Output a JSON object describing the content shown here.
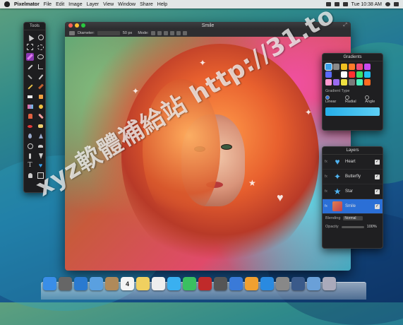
{
  "menubar": {
    "items": [
      "Pixelmator",
      "File",
      "Edit",
      "Image",
      "Layer",
      "View",
      "Window",
      "Share",
      "Help"
    ],
    "clock": "Tue 10:38 AM"
  },
  "tools_panel": {
    "title": "Tools"
  },
  "window": {
    "title": "Smile",
    "options": {
      "diameter_label": "Diameter:",
      "diameter_value": "50 px",
      "mode_label": "Mode:"
    }
  },
  "gradients_panel": {
    "title": "Gradients",
    "type_label": "Gradient Type",
    "types": [
      "Linear",
      "Radial",
      "Angle"
    ],
    "swatches": [
      "#3aa0e8",
      "#8a8a8a",
      "#f0c020",
      "#ff7a2a",
      "#f04a7a",
      "#c84af0",
      "#5a6aff",
      "#1a1a1a",
      "#ffffff",
      "#ff3030",
      "#3adf6a",
      "#20c0f0",
      "#ff9ad0",
      "#9a6af0",
      "#f0e040",
      "#7a7a7a",
      "#4af0c0",
      "#ff6a20"
    ]
  },
  "layers_panel": {
    "title": "Layers",
    "layers": [
      {
        "name": "Heart",
        "icon": "heart-icon",
        "selected": false
      },
      {
        "name": "Butterfly",
        "icon": "butterfly-icon",
        "selected": false
      },
      {
        "name": "Star",
        "icon": "star-icon",
        "selected": false
      },
      {
        "name": "Smile",
        "icon": "photo-thumbnail",
        "selected": true
      }
    ],
    "blending_label": "Blending",
    "blending_value": "Normal",
    "opacity_label": "Opacity",
    "opacity_value": "100%"
  },
  "dock": {
    "icons": [
      "finder-icon",
      "launchpad-icon",
      "safari-icon",
      "mail-icon",
      "contacts-icon",
      "calendar-icon",
      "notes-icon",
      "reminders-icon",
      "messages-icon",
      "facetime-icon",
      "photo-booth-icon",
      "iphoto-icon",
      "itunes-icon",
      "ibooks-icon",
      "app-store-icon",
      "preferences-icon",
      "pixelmator-icon",
      "applications-folder-icon",
      "trash-icon"
    ],
    "calendar_day": "4"
  },
  "watermark": "xyz軟體補給站 http://31.to",
  "colors": {
    "accent": "#2b6fd6",
    "gradient_start": "#26aee8",
    "gradient_end": "#5ecff4"
  }
}
